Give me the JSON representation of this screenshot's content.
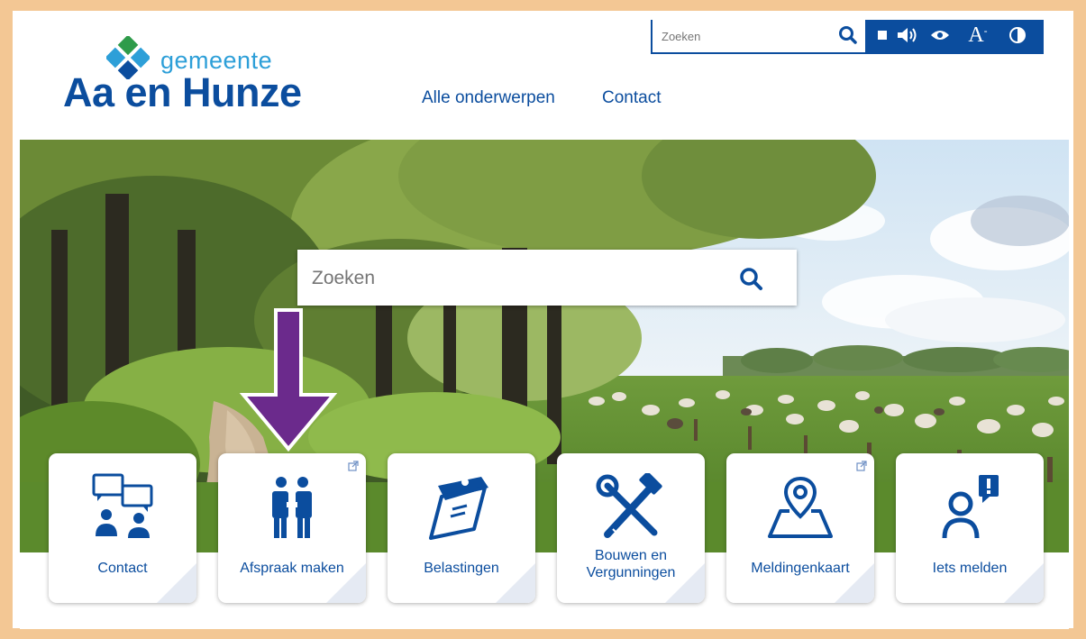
{
  "header": {
    "logo_prefix": "gemeente",
    "logo_name": "Aa en Hunze",
    "nav": [
      "Alle onderwerpen",
      "Contact"
    ]
  },
  "top_search": {
    "placeholder": "Zoeken"
  },
  "toolbar": {
    "icons": [
      "stop-icon",
      "speaker-icon",
      "eye-icon",
      "font-size-icon",
      "contrast-icon"
    ]
  },
  "hero_search": {
    "placeholder": "Zoeken"
  },
  "tiles": [
    {
      "label": "Contact",
      "icon": "chat-people-icon",
      "external": false
    },
    {
      "label": "Afspraak maken",
      "icon": "appointment-people-icon",
      "external": true
    },
    {
      "label": "Belastingen",
      "icon": "tax-document-icon",
      "external": false
    },
    {
      "label": "Bouwen en Vergunningen",
      "line1": "Bouwen en",
      "line2": "Vergunningen",
      "icon": "tools-icon",
      "external": false
    },
    {
      "label": "Meldingenkaart",
      "icon": "map-pin-icon",
      "external": true
    },
    {
      "label": "Iets melden",
      "icon": "report-person-icon",
      "external": false
    }
  ],
  "colors": {
    "brand": "#0b4d9e",
    "logo_light": "#2d9fd8",
    "logo_green": "#2e9b4a",
    "arrow": "#6b2a8c",
    "frame": "#f3c794"
  }
}
